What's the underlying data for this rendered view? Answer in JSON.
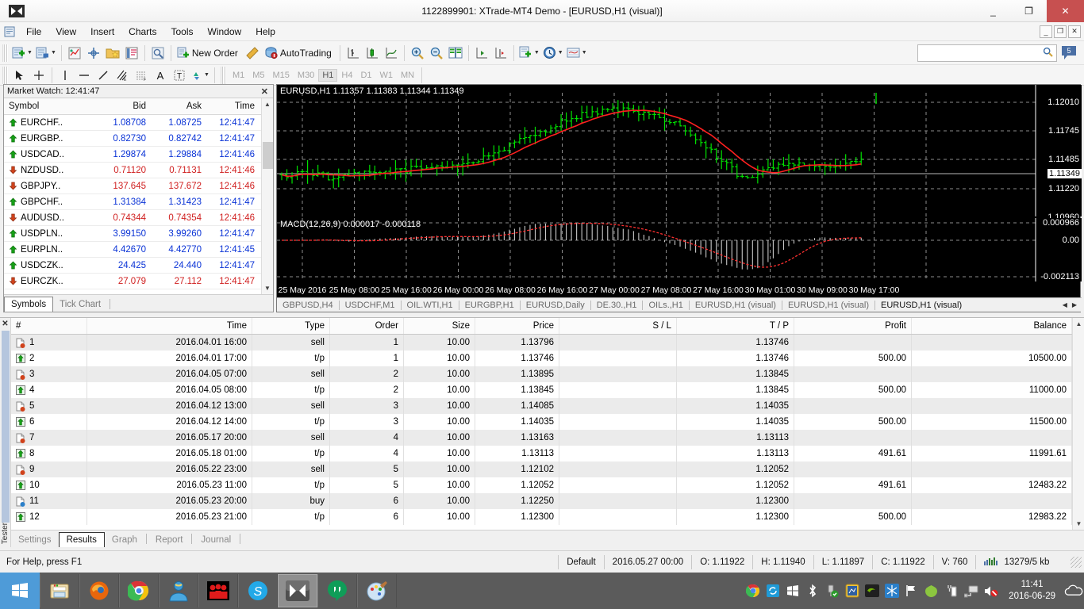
{
  "window": {
    "title": "1122899901: XTrade-MT4 Demo - [EURUSD,H1 (visual)]",
    "minimize": "_",
    "maximize": "❐",
    "close": "✕"
  },
  "menubar": {
    "items": [
      "File",
      "View",
      "Insert",
      "Charts",
      "Tools",
      "Window",
      "Help"
    ],
    "mdi": {
      "minimize": "_",
      "restore": "❐",
      "close": "✕"
    }
  },
  "toolbar": {
    "new_order_label": "New Order",
    "autotrading_label": "AutoTrading",
    "search_placeholder": "",
    "message_count": "5"
  },
  "timeframes": {
    "items": [
      "M1",
      "M5",
      "M15",
      "M30",
      "H1",
      "H4",
      "D1",
      "W1",
      "MN"
    ],
    "active": "H1"
  },
  "market_watch": {
    "title": "Market Watch: 12:41:47",
    "close_glyph": "✕",
    "columns": [
      "Symbol",
      "Bid",
      "Ask",
      "Time"
    ],
    "rows": [
      {
        "symbol": "EURCHF..",
        "bid": "1.08708",
        "ask": "1.08725",
        "time": "12:41:47",
        "dir": "up"
      },
      {
        "symbol": "EURGBP..",
        "bid": "0.82730",
        "ask": "0.82742",
        "time": "12:41:47",
        "dir": "up"
      },
      {
        "symbol": "USDCAD..",
        "bid": "1.29874",
        "ask": "1.29884",
        "time": "12:41:46",
        "dir": "up"
      },
      {
        "symbol": "NZDUSD..",
        "bid": "0.71120",
        "ask": "0.71131",
        "time": "12:41:46",
        "dir": "down"
      },
      {
        "symbol": "GBPJPY..",
        "bid": "137.645",
        "ask": "137.672",
        "time": "12:41:46",
        "dir": "down"
      },
      {
        "symbol": "GBPCHF..",
        "bid": "1.31384",
        "ask": "1.31423",
        "time": "12:41:47",
        "dir": "up"
      },
      {
        "symbol": "AUDUSD..",
        "bid": "0.74344",
        "ask": "0.74354",
        "time": "12:41:46",
        "dir": "down"
      },
      {
        "symbol": "USDPLN..",
        "bid": "3.99150",
        "ask": "3.99260",
        "time": "12:41:47",
        "dir": "up"
      },
      {
        "symbol": "EURPLN..",
        "bid": "4.42670",
        "ask": "4.42770",
        "time": "12:41:45",
        "dir": "up"
      },
      {
        "symbol": "USDCZK..",
        "bid": "24.425",
        "ask": "24.440",
        "time": "12:41:47",
        "dir": "up"
      },
      {
        "symbol": "EURCZK..",
        "bid": "27.079",
        "ask": "27.112",
        "time": "12:41:47",
        "dir": "down"
      }
    ],
    "tabs": [
      {
        "label": "Symbols",
        "active": true
      },
      {
        "label": "Tick Chart",
        "active": false
      }
    ]
  },
  "chart": {
    "main_label": "EURUSD,H1  1.11357 1.11383 1.11344 1.11349",
    "sub_label": "MACD(12,26,9) 0.000017 -0.000118",
    "price_ticks": [
      "1.12010",
      "1.11745",
      "1.11485",
      "1.11220",
      "1.10960"
    ],
    "current_price": "1.11349",
    "macd_ticks": [
      "0.000966",
      "0.00",
      "-0.002113"
    ],
    "time_labels": [
      "25 May 2016",
      "25 May 08:00",
      "25 May 16:00",
      "26 May 00:00",
      "26 May 08:00",
      "26 May 16:00",
      "27 May 00:00",
      "27 May 08:00",
      "27 May 16:00",
      "30 May 01:00",
      "30 May 09:00",
      "30 May 17:00"
    ],
    "tabs": [
      {
        "label": "GBPUSD,H4",
        "active": false
      },
      {
        "label": "USDCHF,M1",
        "active": false
      },
      {
        "label": "OIL.WTI,H1",
        "active": false
      },
      {
        "label": "EURGBP,H1",
        "active": false
      },
      {
        "label": "EURUSD,Daily",
        "active": false
      },
      {
        "label": "DE.30.,H1",
        "active": false
      },
      {
        "label": "OILs.,H1",
        "active": false
      },
      {
        "label": "EURUSD,H1 (visual)",
        "active": false
      },
      {
        "label": "EURUSD,H1 (visual)",
        "active": false
      },
      {
        "label": "EURUSD,H1 (visual)",
        "active": true
      }
    ],
    "nav_left": "◀",
    "nav_right": "▶"
  },
  "chart_data": {
    "type": "line",
    "title": "EURUSD,H1 (visual)",
    "series": [
      {
        "name": "OHLC bars",
        "color": "#00e000"
      },
      {
        "name": "Moving Average",
        "color": "#ff2020"
      },
      {
        "name": "MACD histogram",
        "color": "#c0c0c0"
      },
      {
        "name": "MACD signal",
        "color": "#ff2020"
      }
    ],
    "ylim": [
      1.1096,
      1.1201
    ],
    "macd_ylim": [
      -0.002113,
      0.000966
    ],
    "xlabel": "",
    "ylabel": "",
    "grid": true
  },
  "results": {
    "columns": [
      "#",
      "Time",
      "Type",
      "Order",
      "Size",
      "Price",
      "S / L",
      "T / P",
      "Profit",
      "Balance"
    ],
    "rows": [
      {
        "n": "1",
        "icon": "sell",
        "time": "2016.04.01 16:00",
        "type": "sell",
        "order": "1",
        "size": "10.00",
        "price": "1.13796",
        "sl": "",
        "tp": "1.13746",
        "profit": "",
        "balance": ""
      },
      {
        "n": "2",
        "icon": "tp",
        "time": "2016.04.01 17:00",
        "type": "t/p",
        "order": "1",
        "size": "10.00",
        "price": "1.13746",
        "sl": "",
        "tp": "1.13746",
        "profit": "500.00",
        "balance": "10500.00"
      },
      {
        "n": "3",
        "icon": "sell",
        "time": "2016.04.05 07:00",
        "type": "sell",
        "order": "2",
        "size": "10.00",
        "price": "1.13895",
        "sl": "",
        "tp": "1.13845",
        "profit": "",
        "balance": ""
      },
      {
        "n": "4",
        "icon": "tp",
        "time": "2016.04.05 08:00",
        "type": "t/p",
        "order": "2",
        "size": "10.00",
        "price": "1.13845",
        "sl": "",
        "tp": "1.13845",
        "profit": "500.00",
        "balance": "11000.00"
      },
      {
        "n": "5",
        "icon": "sell",
        "time": "2016.04.12 13:00",
        "type": "sell",
        "order": "3",
        "size": "10.00",
        "price": "1.14085",
        "sl": "",
        "tp": "1.14035",
        "profit": "",
        "balance": ""
      },
      {
        "n": "6",
        "icon": "tp",
        "time": "2016.04.12 14:00",
        "type": "t/p",
        "order": "3",
        "size": "10.00",
        "price": "1.14035",
        "sl": "",
        "tp": "1.14035",
        "profit": "500.00",
        "balance": "11500.00"
      },
      {
        "n": "7",
        "icon": "sell",
        "time": "2016.05.17 20:00",
        "type": "sell",
        "order": "4",
        "size": "10.00",
        "price": "1.13163",
        "sl": "",
        "tp": "1.13113",
        "profit": "",
        "balance": ""
      },
      {
        "n": "8",
        "icon": "tp",
        "time": "2016.05.18 01:00",
        "type": "t/p",
        "order": "4",
        "size": "10.00",
        "price": "1.13113",
        "sl": "",
        "tp": "1.13113",
        "profit": "491.61",
        "balance": "11991.61"
      },
      {
        "n": "9",
        "icon": "sell",
        "time": "2016.05.22 23:00",
        "type": "sell",
        "order": "5",
        "size": "10.00",
        "price": "1.12102",
        "sl": "",
        "tp": "1.12052",
        "profit": "",
        "balance": ""
      },
      {
        "n": "10",
        "icon": "tp",
        "time": "2016.05.23 11:00",
        "type": "t/p",
        "order": "5",
        "size": "10.00",
        "price": "1.12052",
        "sl": "",
        "tp": "1.12052",
        "profit": "491.61",
        "balance": "12483.22"
      },
      {
        "n": "11",
        "icon": "buy",
        "time": "2016.05.23 20:00",
        "type": "buy",
        "order": "6",
        "size": "10.00",
        "price": "1.12250",
        "sl": "",
        "tp": "1.12300",
        "profit": "",
        "balance": ""
      },
      {
        "n": "12",
        "icon": "tp",
        "time": "2016.05.23 21:00",
        "type": "t/p",
        "order": "6",
        "size": "10.00",
        "price": "1.12300",
        "sl": "",
        "tp": "1.12300",
        "profit": "500.00",
        "balance": "12983.22"
      }
    ],
    "tabs": [
      {
        "label": "Settings",
        "active": false
      },
      {
        "label": "Results",
        "active": true
      },
      {
        "label": "Graph",
        "active": false
      },
      {
        "label": "Report",
        "active": false
      },
      {
        "label": "Journal",
        "active": false
      }
    ],
    "panel_label": "Tester",
    "close_glyph": "✕"
  },
  "statusbar": {
    "help": "For Help, press F1",
    "profile": "Default",
    "bar_time": "2016.05.27 00:00",
    "open": "O: 1.11922",
    "high": "H: 1.11940",
    "low": "L: 1.11897",
    "close": "C: 1.11922",
    "volume": "V: 760",
    "traffic": "13279/5 kb"
  },
  "taskbar": {
    "apps": [
      {
        "name": "file-explorer-icon"
      },
      {
        "name": "firefox-icon"
      },
      {
        "name": "chrome-icon"
      },
      {
        "name": "teamviewer-icon"
      },
      {
        "name": "app-red-icon"
      },
      {
        "name": "skype-icon"
      },
      {
        "name": "metatrader-icon",
        "active": true
      },
      {
        "name": "hangouts-icon"
      },
      {
        "name": "paint-icon"
      }
    ],
    "time": "11:41",
    "date": "2016-06-29"
  }
}
